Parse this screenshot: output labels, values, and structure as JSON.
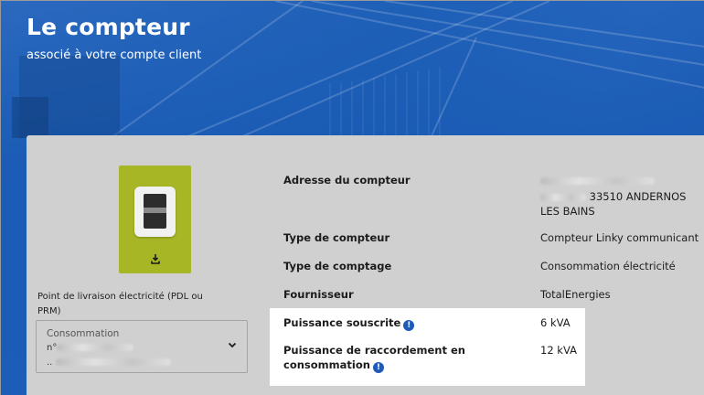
{
  "header": {
    "title": "Le compteur",
    "subtitle": "associé à votre compte client"
  },
  "colors": {
    "hero_blue": "#1d5fb4",
    "meter_tile": "#a6b625",
    "card_bg": "#d0d0d0",
    "info_icon": "#1e5bb8"
  },
  "meter": {
    "icon": "linky-meter-icon",
    "download_icon": "download-icon"
  },
  "pdl": {
    "label": "Point de livraison électricité (PDL ou PRM)",
    "select_kind": "Consommation",
    "select_number_prefix": "n°",
    "select_address_prefix": ".. ",
    "chevron_icon": "chevron-down-icon"
  },
  "details": {
    "address_label": "Adresse du compteur",
    "address_value": "33510 ANDERNOS LES BAINS",
    "type_label": "Type de compteur",
    "type_value": "Compteur Linky communicant",
    "comptage_label": "Type de comptage",
    "comptage_value": "Consommation électricité",
    "fournisseur_label": "Fournisseur",
    "fournisseur_value": "TotalEnergies",
    "puissance_label": "Puissance souscrite",
    "puissance_value": "6 kVA",
    "raccordement_label_1": "Puissance de raccordement en",
    "raccordement_label_2": "consommation",
    "raccordement_value": "12 kVA",
    "info_glyph": "!"
  }
}
